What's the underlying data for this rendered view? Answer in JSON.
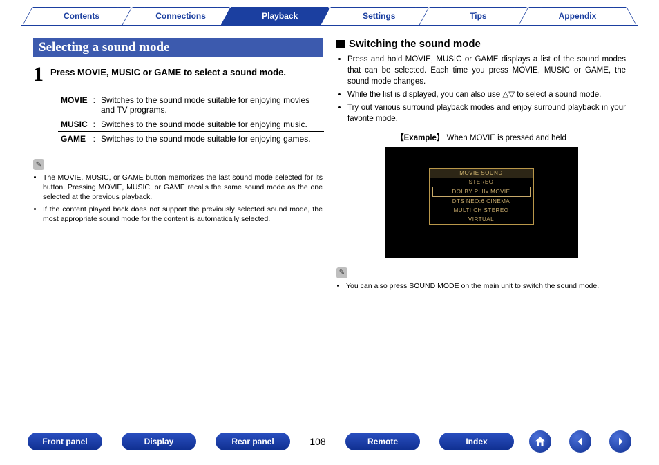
{
  "tabs": [
    "Contents",
    "Connections",
    "Playback",
    "Settings",
    "Tips",
    "Appendix"
  ],
  "active_tab": 2,
  "left": {
    "heading": "Selecting a sound mode",
    "step_num": "1",
    "step_text": "Press MOVIE, MUSIC or GAME to select a sound mode.",
    "modes": [
      {
        "name": "MOVIE",
        "desc": "Switches to the sound mode suitable for enjoying movies and TV programs."
      },
      {
        "name": "MUSIC",
        "desc": "Switches to the sound mode suitable for enjoying music."
      },
      {
        "name": "GAME",
        "desc": "Switches to the sound mode suitable for enjoying games."
      }
    ],
    "notes": [
      "The MOVIE, MUSIC, or GAME button memorizes the last sound mode selected for its button. Pressing MOVIE, MUSIC, or GAME recalls the same sound mode as the one selected at the previous playback.",
      "If the content played back does not support the previously selected sound mode, the most appropriate sound mode for the content is automatically selected."
    ]
  },
  "right": {
    "subhead": "Switching the sound mode",
    "bullets": [
      "Press and hold MOVIE, MUSIC or GAME displays a list of the sound modes that can be selected. Each time you press MOVIE, MUSIC or GAME, the sound mode changes.",
      "While the list is displayed, you can also use △▽ to select a sound mode.",
      "Try out various surround playback modes and enjoy surround playback in your favorite mode."
    ],
    "example_label": "【Example】",
    "example_text": "When MOVIE is pressed and held",
    "osd": {
      "title": "MOVIE SOUND",
      "items": [
        "STEREO",
        "DOLBY PLIIx MOVIE",
        "DTS NEO:6 CINEMA",
        "MULTI CH STEREO",
        "VIRTUAL"
      ],
      "selected": 1
    },
    "note": "You can also press SOUND MODE on the main unit to switch the sound mode."
  },
  "footer": {
    "pills": [
      "Front panel",
      "Display",
      "Rear panel"
    ],
    "page": "108",
    "pills2": [
      "Remote",
      "Index"
    ]
  }
}
